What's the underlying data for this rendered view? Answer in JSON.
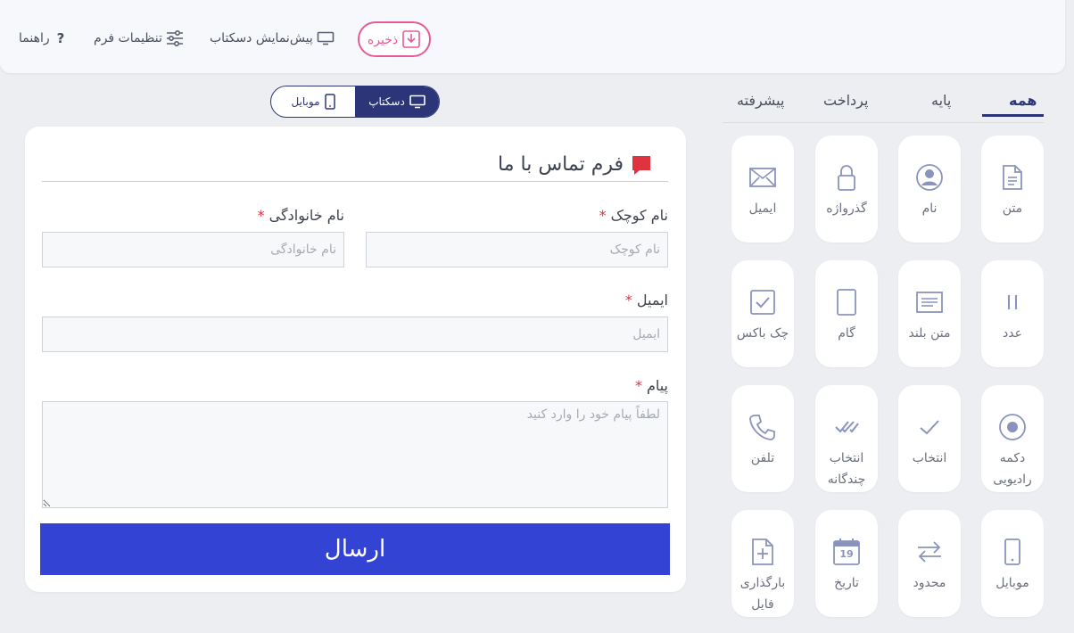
{
  "toolbar": {
    "help_label": "راهنما",
    "help_icon": "?",
    "settings_label": "تنظیمات فرم",
    "preview_label": "پیش‌نمایش دسکتاب",
    "save_label": "ذخیره"
  },
  "preview_toggle": {
    "mobile_label": "موبایل",
    "desktop_label": "دسکتاپ",
    "selected": "desktop"
  },
  "form": {
    "title": "فرم تماس با ما",
    "first_name": {
      "label": "نام کوچک",
      "required_mark": "*",
      "placeholder": "نام کوچک",
      "value": ""
    },
    "last_name": {
      "label": "نام خانوادگی",
      "required_mark": "*",
      "placeholder": "نام خانوادگی",
      "value": ""
    },
    "email": {
      "label": "ایمیل",
      "required_mark": "*",
      "placeholder": "ایمیل",
      "value": ""
    },
    "message": {
      "label": "پیام",
      "required_mark": "*",
      "placeholder": "لطفاً پیام خود را وارد کنید",
      "value": ""
    },
    "submit_label": "ارسال"
  },
  "palette": {
    "tabs": [
      {
        "label": "همه",
        "active": true
      },
      {
        "label": "پایه",
        "active": false
      },
      {
        "label": "پرداخت",
        "active": false
      },
      {
        "label": "پیشرفته",
        "active": false
      }
    ],
    "items": [
      {
        "label": "متن",
        "icon": "document-icon"
      },
      {
        "label": "نام",
        "icon": "user-circle-icon"
      },
      {
        "label": "گذرواژه",
        "icon": "lock-icon"
      },
      {
        "label": "ایمیل",
        "icon": "envelope-icon"
      },
      {
        "label": "عدد",
        "icon": "number-icon"
      },
      {
        "label": "متن بلند",
        "icon": "paragraph-icon"
      },
      {
        "label": "گام",
        "icon": "step-icon"
      },
      {
        "label": "چک باکس",
        "icon": "checkbox-icon"
      },
      {
        "label": "دکمه رادیویی",
        "icon": "radio-icon"
      },
      {
        "label": "انتخاب",
        "icon": "check-icon"
      },
      {
        "label": "انتخاب چندگانه",
        "icon": "double-check-icon"
      },
      {
        "label": "تلفن",
        "icon": "phone-icon"
      },
      {
        "label": "موبایل",
        "icon": "mobile-icon"
      },
      {
        "label": "محدود",
        "icon": "arrows-icon"
      },
      {
        "label": "تاریخ",
        "icon": "calendar-icon",
        "calendar_day": "19"
      },
      {
        "label": "بارگذاری فایل",
        "icon": "file-upload-icon"
      }
    ]
  },
  "colors": {
    "primary": "#2c3578",
    "submit": "#3344d4",
    "save_accent": "#e85a97",
    "required": "#e0333f",
    "title_icon": "#e0333f",
    "palette_icon": "#8a93bd"
  }
}
